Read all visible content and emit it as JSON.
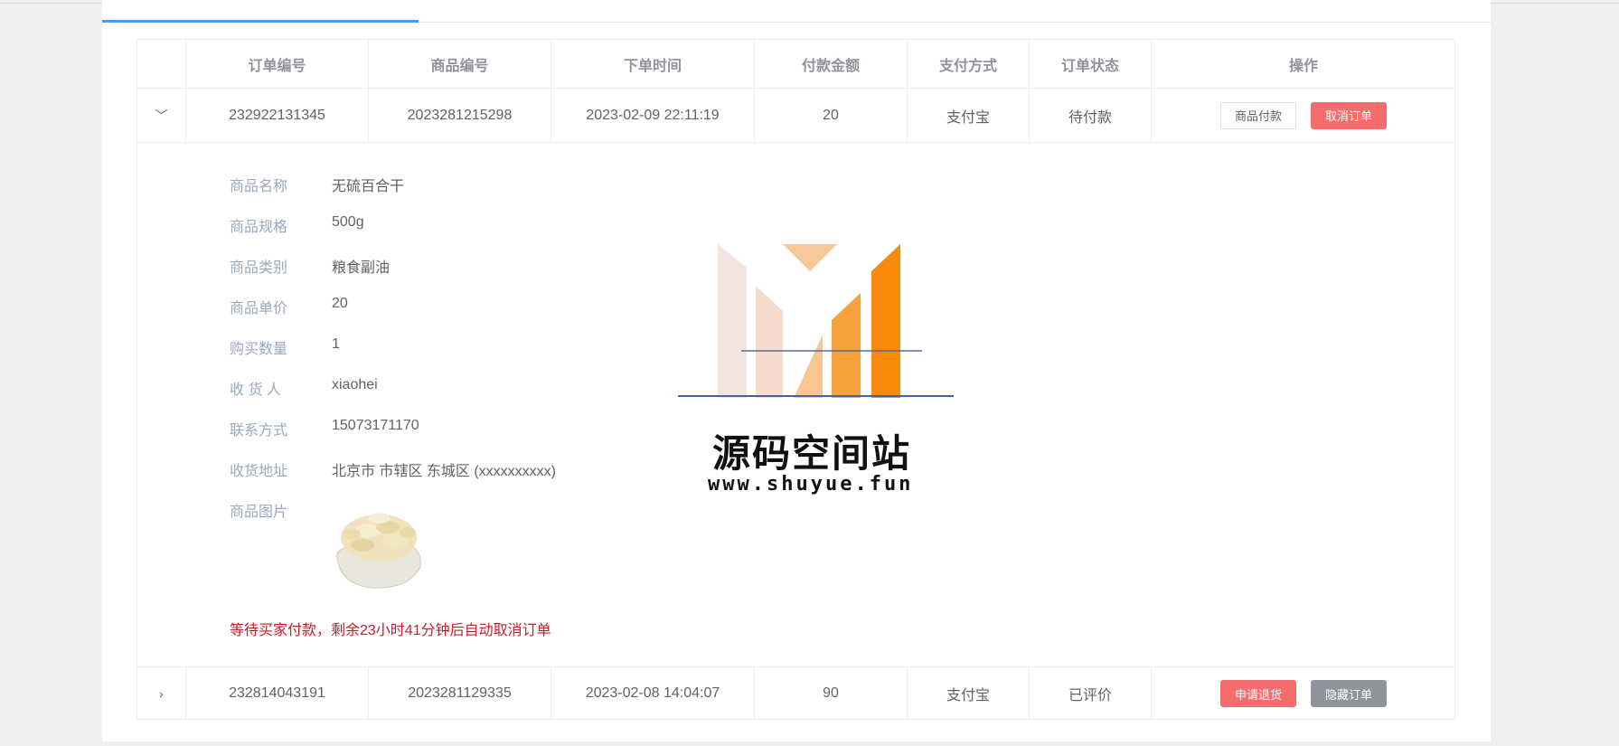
{
  "table": {
    "headers": [
      "订单编号",
      "商品编号",
      "下单时间",
      "付款金额",
      "支付方式",
      "订单状态",
      "操作"
    ],
    "rows": [
      {
        "order_no": "232922131345",
        "product_no": "2023281215298",
        "order_time": "2023-02-09 22:11:19",
        "amount": "20",
        "pay_method": "支付宝",
        "status": "待付款",
        "actions": [
          "商品付款",
          "取消订单"
        ]
      },
      {
        "order_no": "232814043191",
        "product_no": "2023281129335",
        "order_time": "2023-02-08 14:04:07",
        "amount": "90",
        "pay_method": "支付宝",
        "status": "已评价",
        "actions": [
          "申请退货",
          "隐藏订单"
        ]
      }
    ]
  },
  "detail": {
    "fields": [
      {
        "label": "商品名称",
        "value": "无硫百合干"
      },
      {
        "label": "商品规格",
        "value": "500g"
      },
      {
        "label": "商品类别",
        "value": "粮食副油"
      },
      {
        "label": "商品单价",
        "value": "20"
      },
      {
        "label": "购买数量",
        "value": "1"
      },
      {
        "label": "收 货 人",
        "value": "xiaohei"
      },
      {
        "label": "联系方式",
        "value": "15073171170"
      },
      {
        "label": "收货地址",
        "value": "北京市 市辖区 东城区 (xxxxxxxxxx)"
      },
      {
        "label": "商品图片",
        "value": ""
      }
    ],
    "notice": "等待买家付款，剩余23小时41分钟后自动取消订单"
  },
  "watermark": {
    "title": "源码空间站",
    "url": "www.shuyue.fun"
  },
  "colors": {
    "accent": "#409eff",
    "danger": "#f56c6c",
    "info": "#909399",
    "notice": "#c0202c",
    "logo_orange": "#f78a0a"
  }
}
